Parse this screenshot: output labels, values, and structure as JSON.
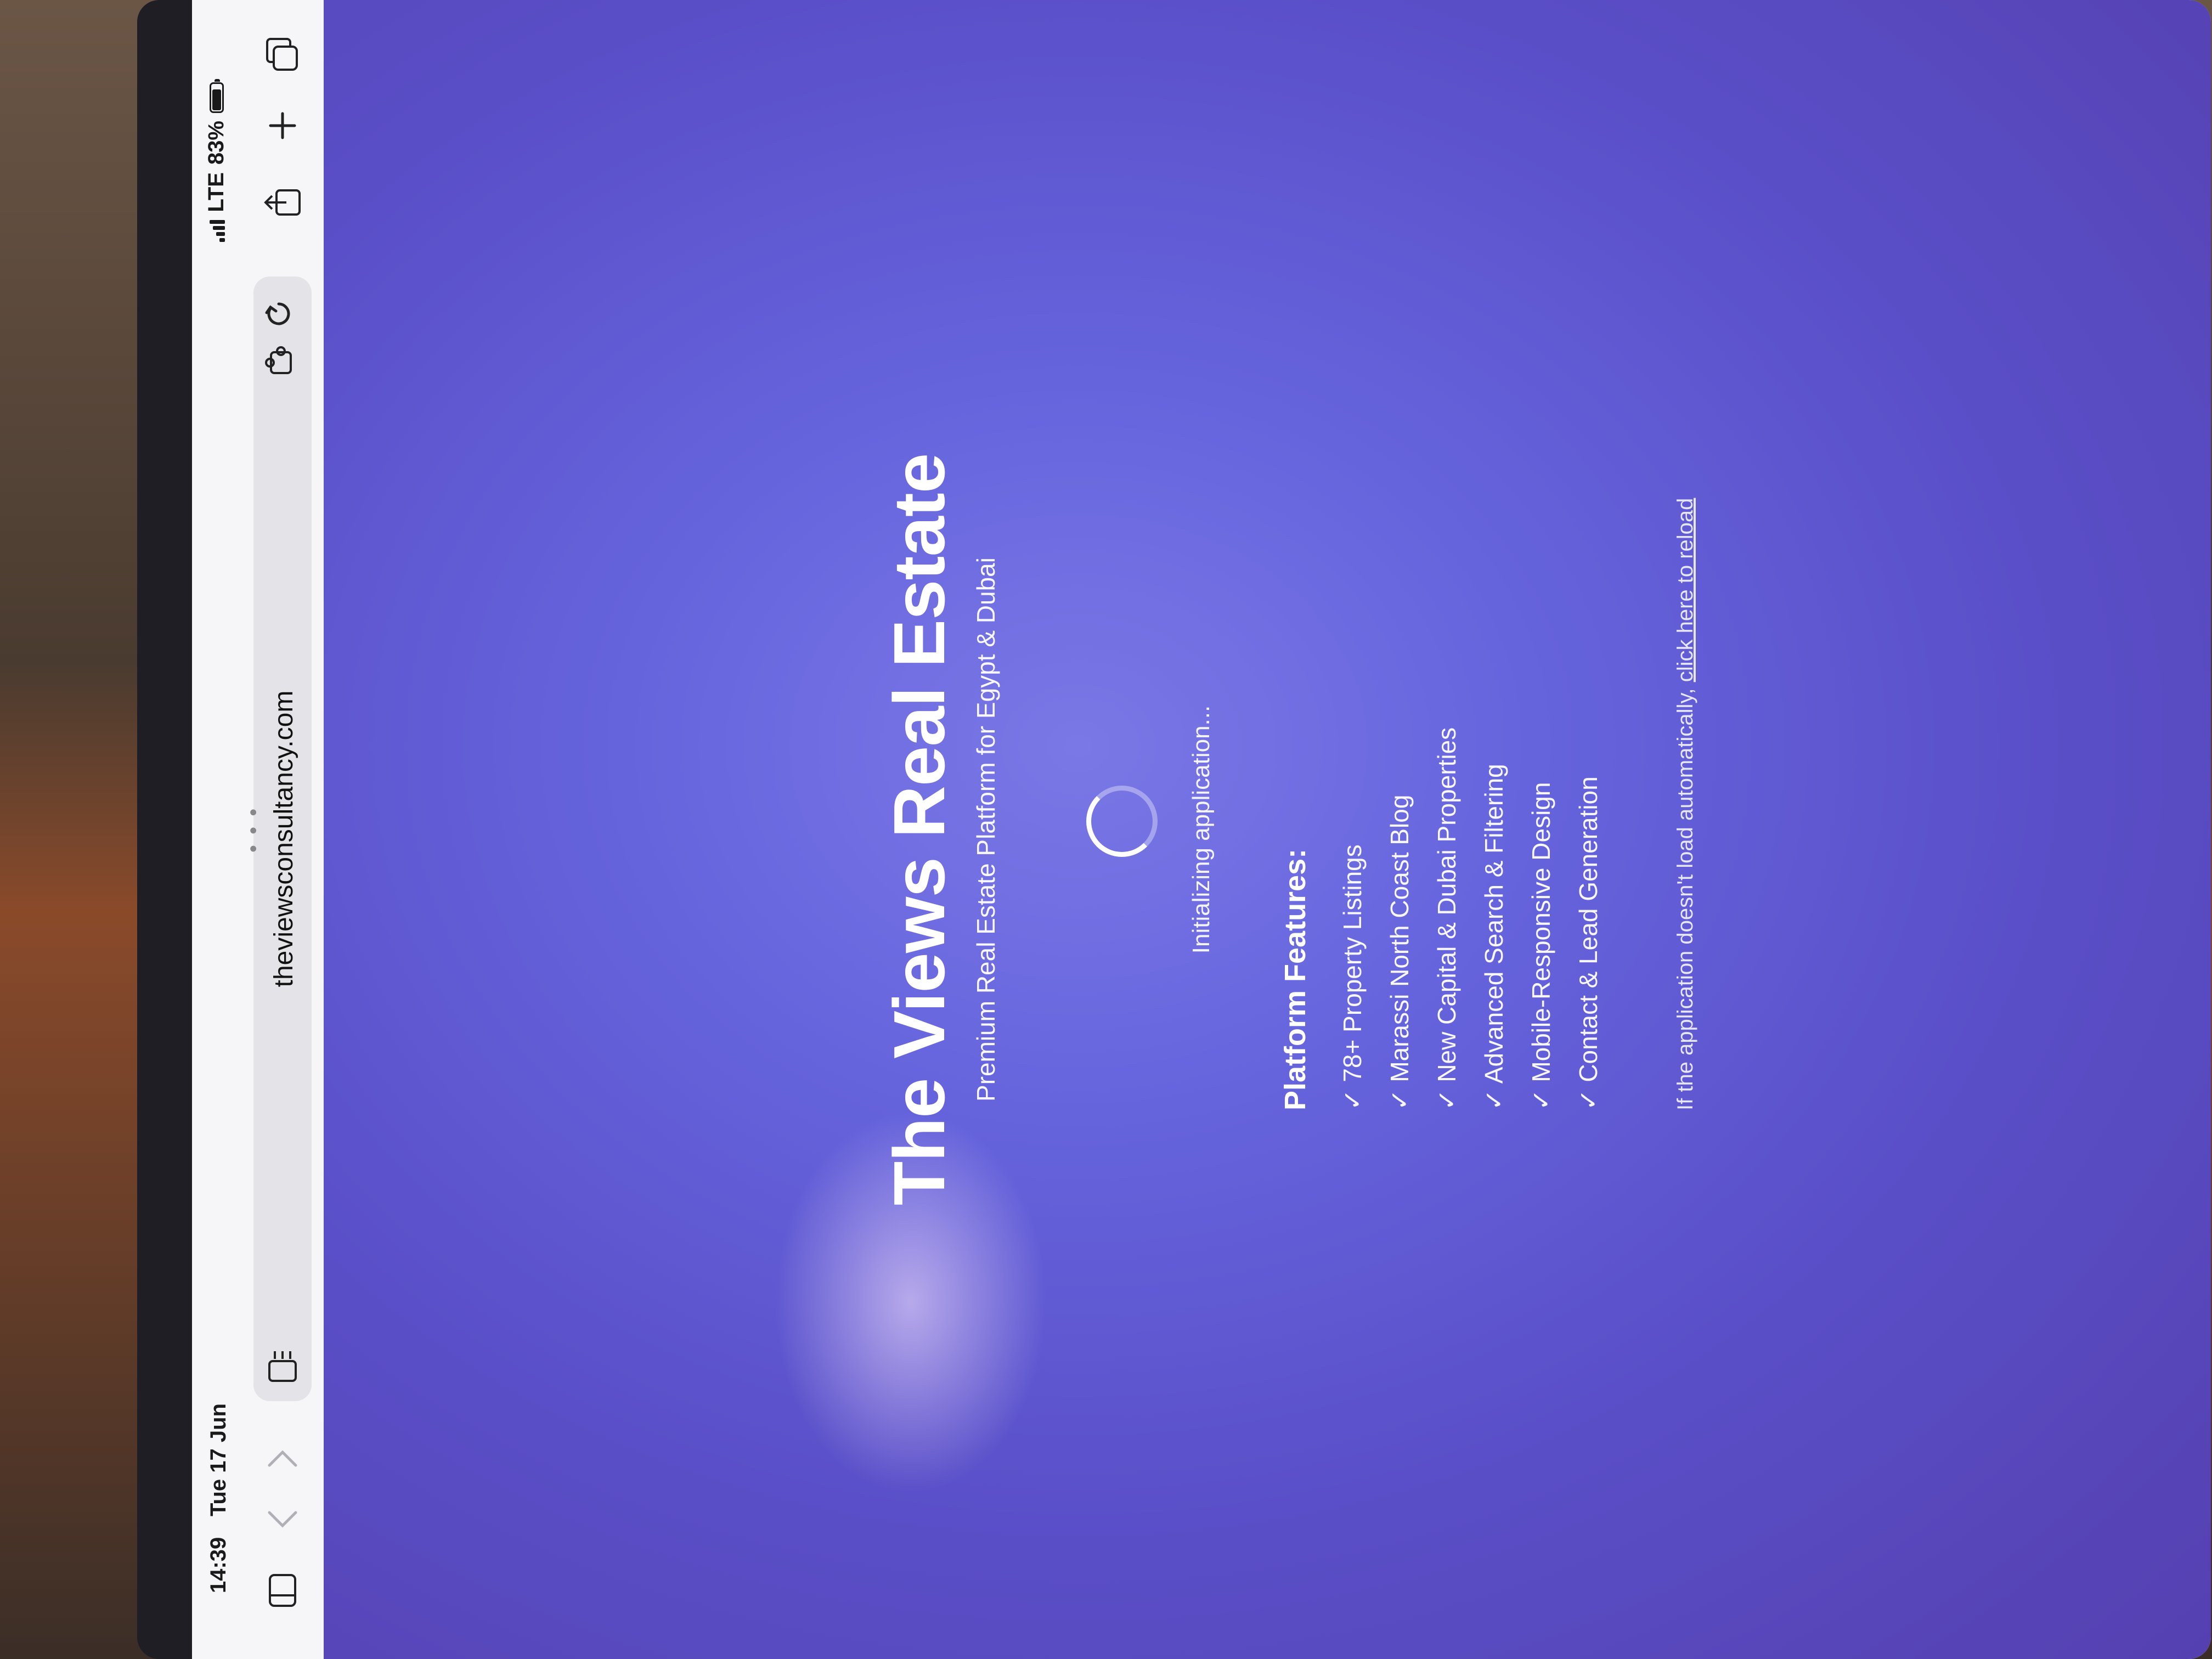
{
  "status_bar": {
    "time": "14:39",
    "date": "Tue 17 Jun",
    "network": "LTE",
    "battery": "83%",
    "battery_level": 0.83
  },
  "toolbar": {
    "sidebar_icon": "sidebar-icon",
    "back_icon": "chevron-left-icon",
    "forward_icon": "chevron-right-icon",
    "reader_icon": "reader-icon",
    "url": "theviewsconsultancy.com",
    "more_icon": "more-dots-icon",
    "extension_icon": "extension-icon",
    "reload_icon": "reload-icon",
    "share_icon": "share-icon",
    "new_tab_icon": "plus-icon",
    "tabs_icon": "tabs-icon"
  },
  "page": {
    "title": "The Views Real Estate",
    "subtitle": "Premium Real Estate Platform for Egypt & Dubai",
    "loading_text": "Initializing application...",
    "features_heading": "Platform Features:",
    "features": [
      "✓ 78+ Property Listings",
      "✓ Marassi North Coast Blog",
      "✓ New Capital & Dubai Properties",
      "✓ Advanced Search & Filtering",
      "✓ Mobile-Responsive Design",
      "✓ Contact & Lead Generation"
    ],
    "reload_prefix": "If the application doesn't load automatically, ",
    "reload_link": "click here to reload"
  },
  "colors": {
    "background_start": "#7a78e6",
    "background_end": "#5540b0",
    "text": "#ffffff"
  }
}
